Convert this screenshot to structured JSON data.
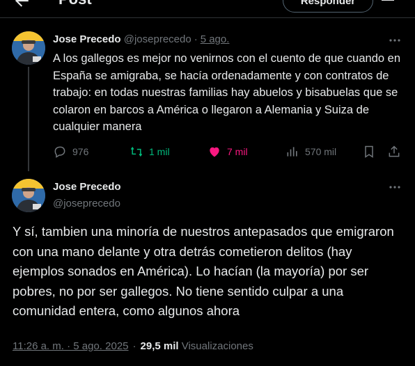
{
  "header": {
    "title": "Post",
    "reply_button": "Responder"
  },
  "tweet1": {
    "name": "Jose Precedo",
    "handle": "@joseprecedo",
    "separator": "·",
    "date": "5 ago.",
    "text": "A los gallegos es mejor no venirnos con el cuento de que cuando en España se amigraba, se hacía ordenadamente y con contratos de trabajo: en todas nuestras familias hay abuelos y bisabuelas que se colaron en barcos a América o llegaron a Alemania y Suiza de cualquier manera",
    "actions": {
      "replies": "976",
      "reposts": "1 mil",
      "likes": "7 mil",
      "views": "570 mil"
    }
  },
  "tweet2": {
    "name": "Jose Precedo",
    "handle": "@joseprecedo",
    "text": "Y sí, tambien una minoría de nuestros antepasados que emigraron con una mano delante y otra detrás cometieron delitos (hay ejemplos sonados en América).  Lo hacían (la mayoría) por ser pobres, no por ser gallegos. No tiene sentido culpar a una comunidad entera, como algunos ahora",
    "time": "11:26 a. m. · 5 ago. 2025",
    "dot": "·",
    "views_count": "29,5 mil",
    "views_label": "Visualizaciones"
  },
  "icons": {
    "back": "arrow-left-icon",
    "more": "more-horizontal-icon",
    "reply": "reply-icon",
    "repost": "repost-icon",
    "like": "heart-icon",
    "views": "views-icon",
    "bookmark": "bookmark-icon",
    "share": "share-icon"
  },
  "colors": {
    "background": "#000000",
    "text": "#e7e9ea",
    "muted": "#71767b",
    "repost_active": "#00ba7c",
    "like_active": "#f91880",
    "divider": "#2f3336"
  }
}
